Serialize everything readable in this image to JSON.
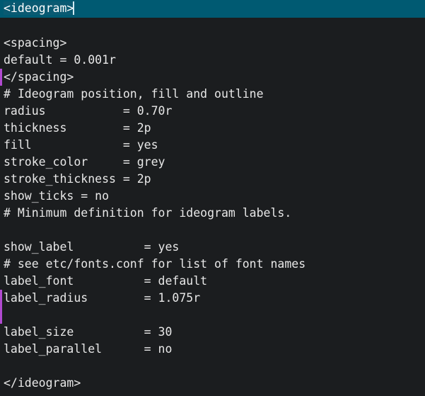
{
  "editor": {
    "background_color": "#1b1d1f",
    "text_color": "#e8e8e8",
    "current_line_highlight_color": "#005a72",
    "change_marker_color": "#b14ad0",
    "caret_color": "#cfe9f2",
    "file_type": "circos-configuration"
  },
  "lines": [
    {
      "n": 1,
      "text": "<ideogram>",
      "current": true,
      "marked": false
    },
    {
      "n": 2,
      "text": "",
      "current": false,
      "marked": false
    },
    {
      "n": 3,
      "text": "<spacing>",
      "current": false,
      "marked": false
    },
    {
      "n": 4,
      "text": "default = 0.001r",
      "current": false,
      "marked": false
    },
    {
      "n": 5,
      "text": "</spacing>",
      "current": false,
      "marked": true
    },
    {
      "n": 6,
      "text": "# Ideogram position, fill and outline",
      "current": false,
      "marked": false
    },
    {
      "n": 7,
      "text": "radius           = 0.70r",
      "current": false,
      "marked": false
    },
    {
      "n": 8,
      "text": "thickness        = 2p",
      "current": false,
      "marked": false
    },
    {
      "n": 9,
      "text": "fill             = yes",
      "current": false,
      "marked": false
    },
    {
      "n": 10,
      "text": "stroke_color     = grey",
      "current": false,
      "marked": false
    },
    {
      "n": 11,
      "text": "stroke_thickness = 2p",
      "current": false,
      "marked": false
    },
    {
      "n": 12,
      "text": "show_ticks = no",
      "current": false,
      "marked": false
    },
    {
      "n": 13,
      "text": "# Minimum definition for ideogram labels.",
      "current": false,
      "marked": false
    },
    {
      "n": 14,
      "text": "",
      "current": false,
      "marked": false
    },
    {
      "n": 15,
      "text": "show_label          = yes",
      "current": false,
      "marked": false
    },
    {
      "n": 16,
      "text": "# see etc/fonts.conf for list of font names",
      "current": false,
      "marked": false
    },
    {
      "n": 17,
      "text": "label_font          = default",
      "current": false,
      "marked": false
    },
    {
      "n": 18,
      "text": "label_radius        = 1.075r",
      "current": false,
      "marked": true
    },
    {
      "n": 19,
      "text": "",
      "current": false,
      "marked": true
    },
    {
      "n": 20,
      "text": "label_size          = 30",
      "current": false,
      "marked": false
    },
    {
      "n": 21,
      "text": "label_parallel      = no",
      "current": false,
      "marked": false
    },
    {
      "n": 22,
      "text": "",
      "current": false,
      "marked": false
    },
    {
      "n": 23,
      "text": "</ideogram>",
      "current": false,
      "marked": false
    }
  ]
}
